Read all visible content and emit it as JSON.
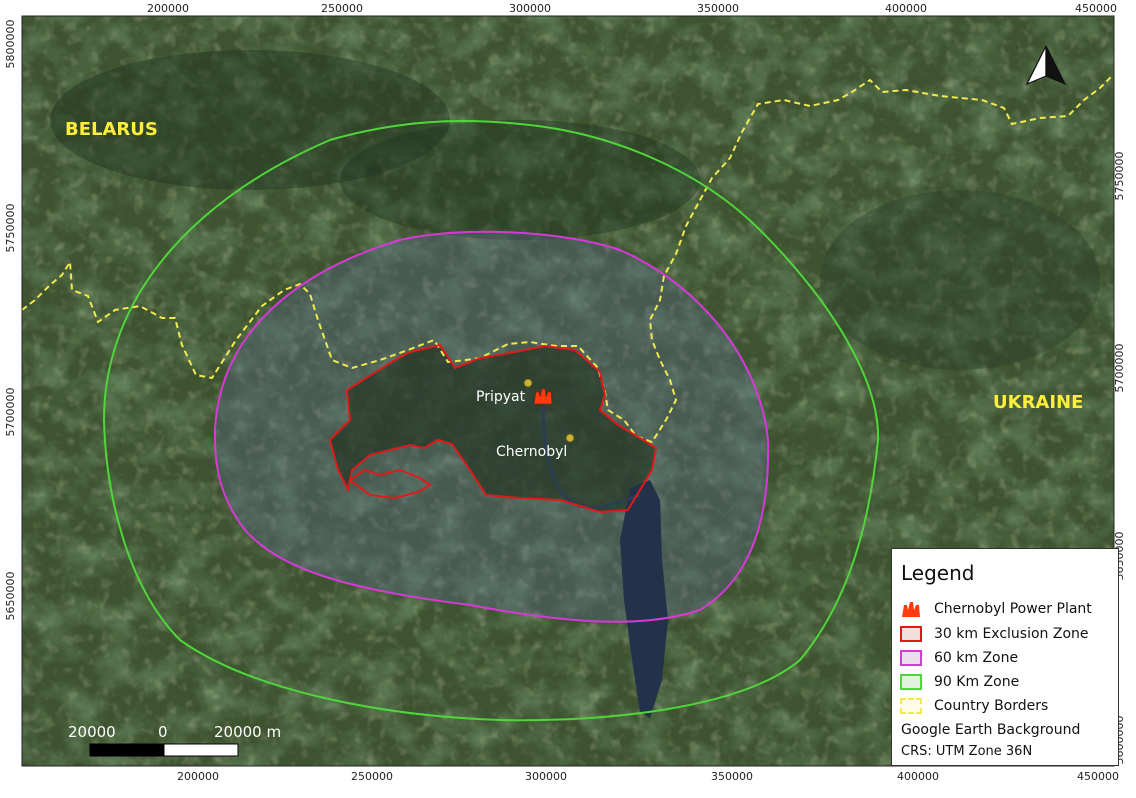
{
  "axes": {
    "x_ticks": [
      "200000",
      "250000",
      "300000",
      "350000",
      "400000",
      "450000"
    ],
    "y_ticks": [
      "5800000",
      "5750000",
      "5700000",
      "5650000",
      "5600000"
    ]
  },
  "countries": {
    "belarus": "BELARUS",
    "ukraine": "UKRAINE"
  },
  "places": {
    "pripyat": "Pripyat",
    "chernobyl": "Chernobyl"
  },
  "legend": {
    "title": "Legend",
    "items": [
      {
        "label": "Chernobyl Power Plant",
        "color": "#ff3b10"
      },
      {
        "label": "30 km Exclusion Zone",
        "color": "#e01a1a"
      },
      {
        "label": "60 km Zone",
        "color": "#d63ad6"
      },
      {
        "label": "90 Km Zone",
        "color": "#4fd63a"
      },
      {
        "label": "Country Borders",
        "color": "#f2e94e"
      }
    ],
    "background_note": "Google Earth Background",
    "crs": "CRS: UTM Zone 36N"
  },
  "scale_bar": {
    "left_label": "20000",
    "center_label": "0",
    "right_label": "20000 m"
  },
  "north_arrow": "north-arrow-icon",
  "colors": {
    "zone_30km": "#e01a1a",
    "zone_60km": "#d63ad6",
    "zone_90km": "#4fd63a",
    "border": "#f2e94e",
    "city_dot": "#c9b23a"
  }
}
